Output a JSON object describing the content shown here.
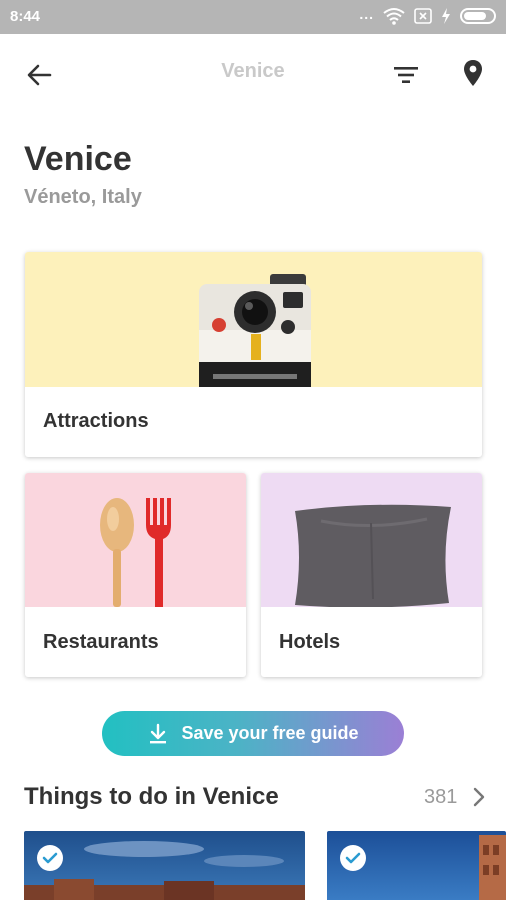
{
  "status_bar": {
    "time": "8:44",
    "dots": "...",
    "icons": [
      "wifi-icon",
      "sim-icon",
      "charging-icon",
      "battery-icon"
    ]
  },
  "app_bar": {
    "title": "Venice",
    "icons": [
      "back-arrow-icon",
      "filter-icon",
      "location-pin-icon"
    ]
  },
  "header": {
    "title": "Venice",
    "subtitle": "Véneto, Italy"
  },
  "categories": [
    {
      "label": "Attractions",
      "color": "#fdf1bb",
      "icon": "camera-icon"
    },
    {
      "label": "Restaurants",
      "color": "#fad6de",
      "icon": "spoon-fork-icon"
    },
    {
      "label": "Hotels",
      "color": "#eedbf3",
      "icon": "pillow-icon"
    }
  ],
  "save_button": {
    "label": "Save your free guide",
    "icon": "download-icon",
    "gradient": [
      "#22c0c2",
      "#9b7fd5"
    ]
  },
  "things_section": {
    "title": "Things to do in Venice",
    "count": "381",
    "icon": "chevron-right-icon"
  },
  "accent": "#22c0c2"
}
